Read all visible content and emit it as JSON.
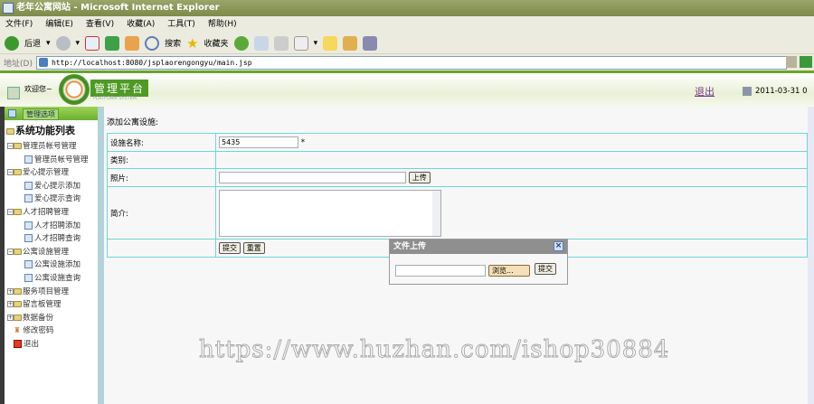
{
  "window": {
    "title": "老年公寓网站 - Microsoft Internet Explorer"
  },
  "menu": [
    "文件(F)",
    "编辑(E)",
    "查看(V)",
    "收藏(A)",
    "工具(T)",
    "帮助(H)"
  ],
  "toolbar": {
    "back": "后退",
    "search": "搜索",
    "favorites": "收藏夹"
  },
  "address": {
    "label": "地址(D)",
    "url": "http://localhost:8080/jsplaorengongyu/main.jsp"
  },
  "header": {
    "welcome": "欢迎您~",
    "logo": "管理平台",
    "logo_sub": "PLATFORM SYSTEM",
    "logout": "退出",
    "date": "2011-03-31 0"
  },
  "sidebar": {
    "tab": "管理选项",
    "root": "系统功能列表",
    "items": [
      {
        "label": "管理员帐号管理",
        "type": "folder",
        "open": true
      },
      {
        "label": "管理员帐号管理",
        "type": "leaf"
      },
      {
        "label": "爱心提示管理",
        "type": "folder",
        "open": true
      },
      {
        "label": "爱心提示添加",
        "type": "leaf"
      },
      {
        "label": "爱心提示查询",
        "type": "leaf"
      },
      {
        "label": "人才招聘管理",
        "type": "folder",
        "open": true
      },
      {
        "label": "人才招聘添加",
        "type": "leaf"
      },
      {
        "label": "人才招聘查询",
        "type": "leaf"
      },
      {
        "label": "公寓设施管理",
        "type": "folder",
        "open": true
      },
      {
        "label": "公寓设施添加",
        "type": "leaf"
      },
      {
        "label": "公寓设施查询",
        "type": "leaf"
      },
      {
        "label": "服务项目管理",
        "type": "folder",
        "open": false
      },
      {
        "label": "留言板管理",
        "type": "folder",
        "open": false
      },
      {
        "label": "数据备份",
        "type": "folder",
        "open": false
      },
      {
        "label": "修改密码",
        "type": "key"
      },
      {
        "label": "退出",
        "type": "exit"
      }
    ]
  },
  "form": {
    "heading": "添加公寓设施:",
    "name_label": "设施名称:",
    "name_value": "5435",
    "required": "*",
    "category_label": "类别:",
    "photo_label": "照片:",
    "upload_button": "上传",
    "intro_label": "简介:",
    "submit": "提交",
    "reset": "重置"
  },
  "dialog": {
    "title": "文件上传",
    "browse": "浏览...",
    "submit": "提交"
  },
  "watermark": "https://www.huzhan.com/ishop30884"
}
